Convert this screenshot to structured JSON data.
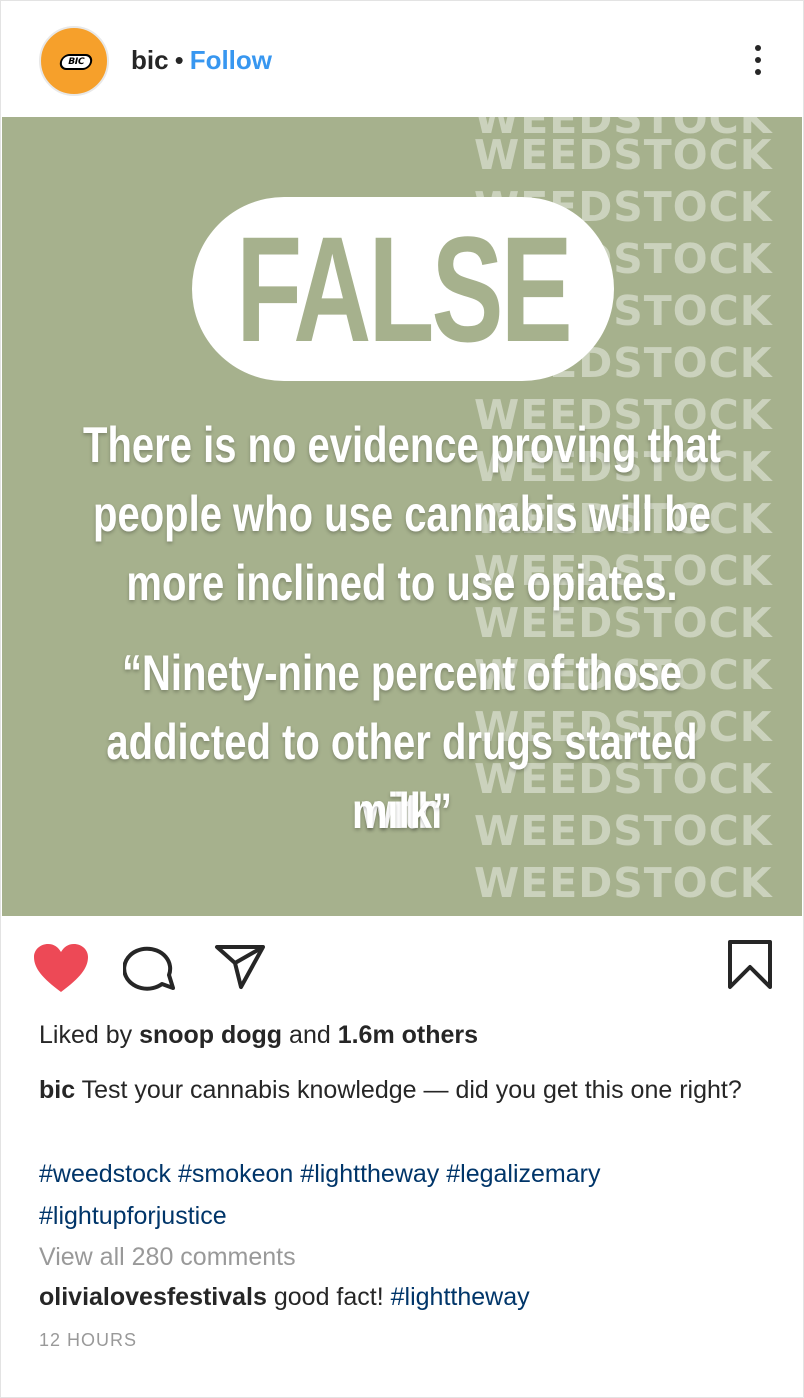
{
  "post": {
    "username": "bic",
    "separator": "•",
    "follow_label": "Follow",
    "more_icon": "more-vertical-icon",
    "avatar_logo_text": "BIC",
    "colors": {
      "image_bg": "#a6b18d",
      "follow": "#3897f0",
      "heart": "#ed4956",
      "hashtag": "#003569"
    }
  },
  "image": {
    "watermark_lines": [
      "WEEDSTOCK",
      "WEEDSTOCK",
      "WEEDSTOCK",
      "WEEDSTOCK",
      "WEEDSTOCK",
      "WEEDSTOCK",
      "WEEDSTOCK",
      "WEEDSTOCK",
      "WEEDSTOCK",
      "WEEDSTOCK",
      "WEEDSTOCK",
      "WEEDSTOCK",
      "WEEDSTOCK",
      "WEEDSTOCK",
      "WEEDSTOCK",
      "WEEDSTOCK"
    ],
    "verdict": "FALSE",
    "fact_lines": [
      "There is no evidence proving that",
      "people who use cannabis will be",
      "more inclined to use opiates."
    ],
    "quote_lines": [
      "“Ninety-nine percent of those",
      "addicted to other drugs started with",
      "milk”"
    ]
  },
  "actions": {
    "like_icon": "heart-icon",
    "liked": true,
    "comment_icon": "comment-icon",
    "share_icon": "share-icon",
    "save_icon": "bookmark-icon"
  },
  "likes": {
    "prefix": "Liked by ",
    "user": "snoop dogg",
    "mid": " and ",
    "count": "1.6m others"
  },
  "caption": {
    "username": "bic",
    "text": "Test your cannabis knowledge — did you get this one right?",
    "hashtags": [
      "#weedstock",
      "#smokeon",
      "#lighttheway",
      "#legalizemary",
      "#lightupforjustice"
    ]
  },
  "view_all_comments": "View all 280 comments",
  "comment": {
    "username": "olivialovesfestivals",
    "text": "good fact!",
    "hashtag": "#lighttheway"
  },
  "timestamp": "12 HOURS"
}
